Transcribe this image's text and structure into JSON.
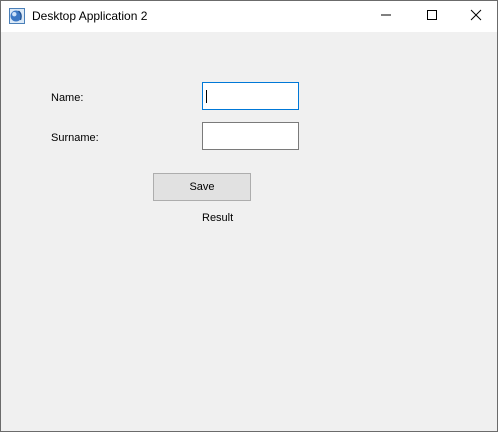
{
  "window": {
    "title": "Desktop Application 2",
    "app_icon": "java-app-icon",
    "controls": {
      "minimize": "minimize-icon",
      "maximize": "maximize-icon",
      "close": "close-icon"
    }
  },
  "form": {
    "name_label": "Name:",
    "name_value": "",
    "surname_label": "Surname:",
    "surname_value": "",
    "save_label": "Save",
    "result_text": "Result"
  },
  "colors": {
    "focus_border": "#0078d7",
    "window_background": "#f0f0f0",
    "titlebar_background": "#ffffff",
    "button_background": "#e1e1e1"
  }
}
